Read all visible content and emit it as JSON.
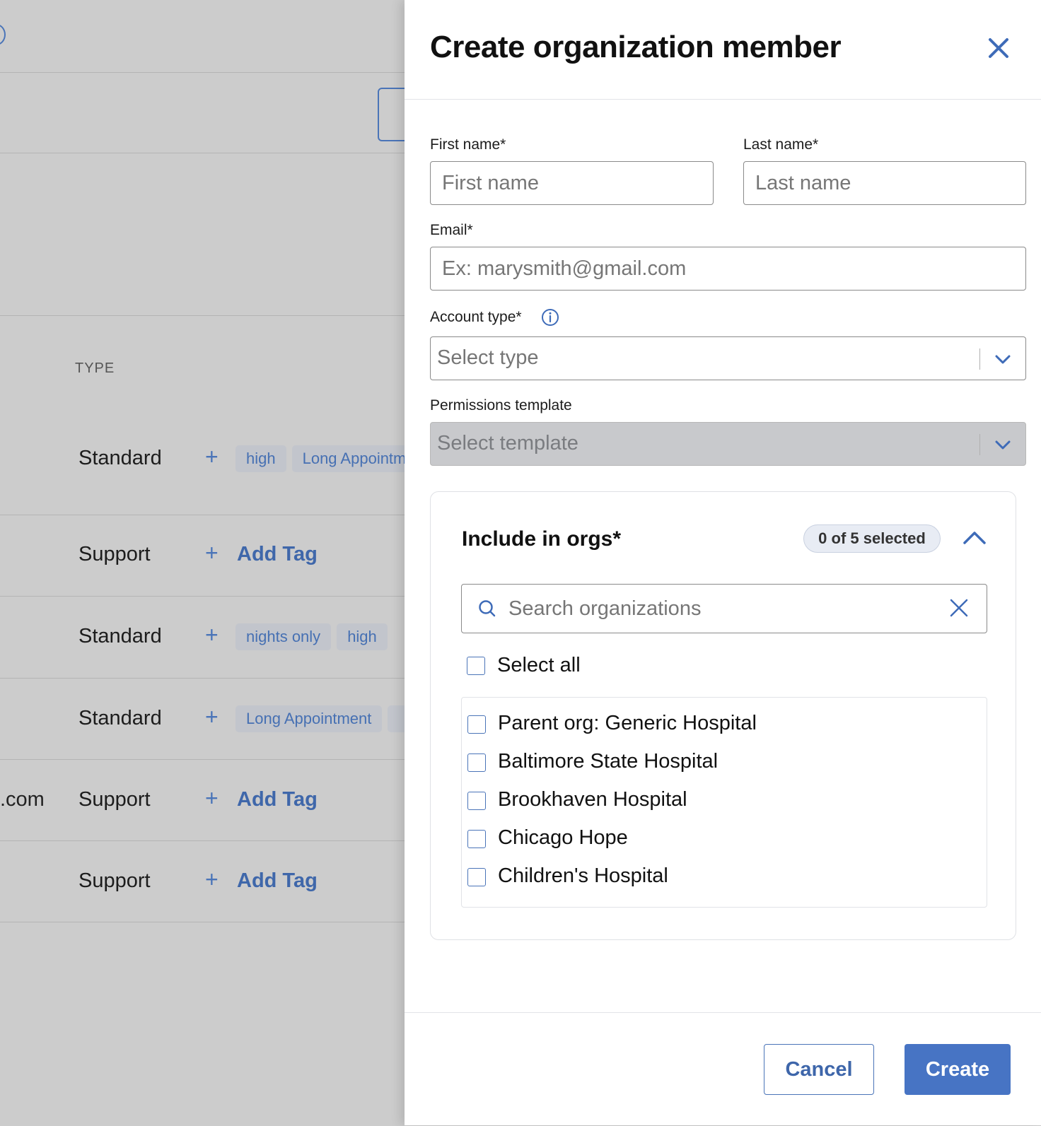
{
  "background": {
    "column_header": "TYPE",
    "rows": [
      {
        "email": "",
        "type": "Standard",
        "tags": [
          "high",
          "Long Appointm"
        ],
        "add_tag": ""
      },
      {
        "email": "",
        "type": "Support",
        "tags": [],
        "add_tag": "Add Tag"
      },
      {
        "email": "",
        "type": "Standard",
        "tags": [
          "nights only",
          "high"
        ],
        "add_tag": ""
      },
      {
        "email": "",
        "type": "Standard",
        "tags": [
          "Long Appointment",
          ""
        ],
        "add_tag": ""
      },
      {
        "email": ".com",
        "type": "Support",
        "tags": [],
        "add_tag": "Add Tag"
      },
      {
        "email": "",
        "type": "Support",
        "tags": [],
        "add_tag": "Add Tag"
      }
    ]
  },
  "drawer": {
    "title": "Create organization member",
    "first_name": {
      "label": "First name*",
      "placeholder": "First name",
      "value": ""
    },
    "last_name": {
      "label": "Last name*",
      "placeholder": "Last name",
      "value": ""
    },
    "email": {
      "label": "Email*",
      "placeholder": "Ex: marysmith@gmail.com",
      "value": ""
    },
    "account_type": {
      "label": "Account type*",
      "placeholder": "Select type"
    },
    "permissions_template": {
      "label": "Permissions template",
      "placeholder": "Select template",
      "disabled": true
    },
    "orgs": {
      "title": "Include in orgs*",
      "badge": "0 of 5 selected",
      "search_placeholder": "Search organizations",
      "select_all_label": "Select all",
      "items": [
        {
          "label": "Parent org: Generic Hospital",
          "checked": false
        },
        {
          "label": "Baltimore State Hospital",
          "checked": false
        },
        {
          "label": "Brookhaven Hospital",
          "checked": false
        },
        {
          "label": "Chicago Hope",
          "checked": false
        },
        {
          "label": "Children's Hospital",
          "checked": false
        }
      ]
    },
    "footer": {
      "cancel_label": "Cancel",
      "create_label": "Create"
    }
  },
  "colors": {
    "accent": "#4774c4",
    "link": "#3f67aa",
    "overlay": "#cccccc"
  }
}
